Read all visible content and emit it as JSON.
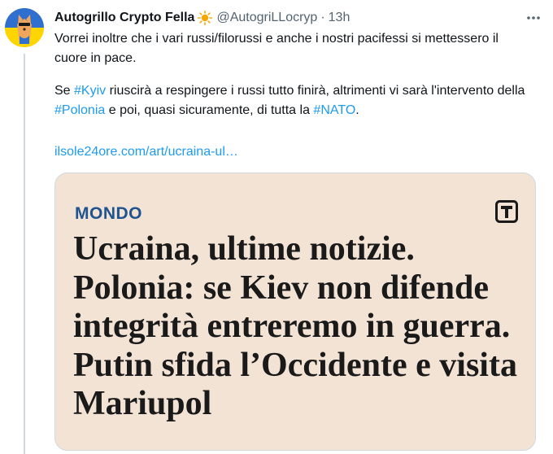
{
  "tweet": {
    "author_name": "Autogrillo Crypto Fella",
    "author_emoji_icon": "sun-icon",
    "author_handle": "@AutogriLLocryp",
    "separator": "·",
    "time": "13h",
    "paragraph1": "Vorrei inoltre che i vari russi/filorussi e anche i nostri pacifessi si mettessero il cuore in pace.",
    "p2": {
      "t1": "Se ",
      "h1": "#Kyiv",
      "t2": " riuscirà a respingere i russi tutto finirà, altrimenti vi sarà l'intervento della ",
      "h2": "#Polonia",
      "t3": " e poi, quasi sicuramente, di tutta la ",
      "h3": "#NATO",
      "t4": "."
    },
    "link_text": "ilsole24ore.com/art/ucraina-ul…"
  },
  "card": {
    "section": "MONDO",
    "headline": "Ucraina, ultime notizie. Polonia: se Kiev non difende integrità entreremo in guerra. Putin sfida l’Occidente e visita Mariupol",
    "logo_icon": "t-logo-icon"
  },
  "colors": {
    "link": "#1d9bf0",
    "card_bg": "#f3e3d4",
    "section_blue": "#1f5491",
    "secondary_text": "#536471"
  }
}
